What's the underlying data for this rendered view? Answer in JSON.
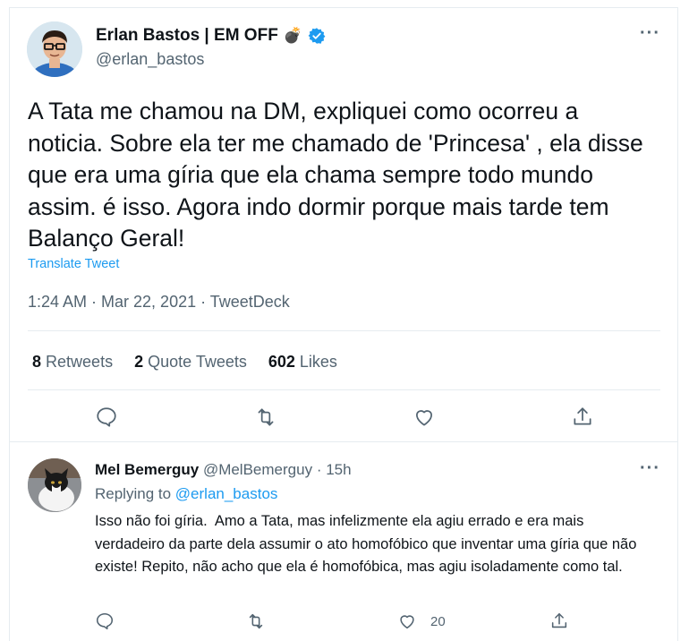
{
  "main_tweet": {
    "author_name": "Erlan Bastos | EM OFF",
    "author_emoji": "💣",
    "verified_icon": "verified-badge-icon",
    "handle": "@erlan_bastos",
    "body": "A Tata me chamou na DM, expliquei como ocorreu a noticia. Sobre ela ter me chamado de 'Princesa' , ela disse que era uma gíria que ela chama sempre todo mundo assim. é isso. Agora indo dormir porque mais tarde tem Balanço Geral!",
    "translate_label": "Translate Tweet",
    "timestamp": "1:24 AM · Mar 22, 2021 · TweetDeck",
    "stats": {
      "retweets_count": "8",
      "retweets_label": "Retweets",
      "quotes_count": "2",
      "quotes_label": "Quote Tweets",
      "likes_count": "602",
      "likes_label": "Likes"
    },
    "actions": [
      "reply-icon",
      "retweet-icon",
      "like-icon",
      "share-icon"
    ]
  },
  "reply": {
    "author_name": "Mel Bemerguy",
    "handle": "@MelBemerguy",
    "dot": "·",
    "time": "15h",
    "replying_prefix": "Replying to",
    "replying_to": "@erlan_bastos",
    "body": "Isso não foi gíria.  Amo a Tata, mas infelizmente ela agiu errado e era mais verdadeiro da parte dela assumir o ato homofóbico que inventar uma gíria que não existe! Repito, não acho que ela é homofóbica, mas agiu isoladamente como tal.",
    "like_count": "20"
  },
  "colors": {
    "accent": "#1d9bf0",
    "secondary_text": "#536471",
    "border": "#e6ecf0"
  }
}
